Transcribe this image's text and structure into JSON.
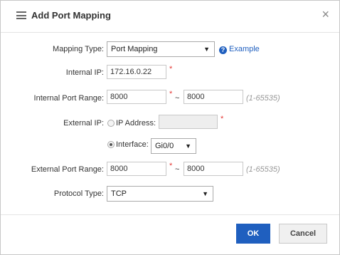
{
  "dialog": {
    "title": "Add Port Mapping",
    "close_glyph": "×"
  },
  "form": {
    "mapping_type": {
      "label": "Mapping Type:",
      "value": "Port Mapping",
      "help": "Example"
    },
    "internal_ip": {
      "label": "Internal IP:",
      "value": "172.16.0.22"
    },
    "internal_port_range": {
      "label": "Internal Port Range:",
      "from": "8000",
      "to": "8000",
      "hint": "(1-65535)"
    },
    "external_ip": {
      "label": "External IP:",
      "option_ip": "IP Address:",
      "ip_value": "",
      "option_interface": "Interface:",
      "interface_value": "Gi0/0",
      "selected": "interface"
    },
    "external_port_range": {
      "label": "External Port Range:",
      "from": "8000",
      "to": "8000",
      "hint": "(1-65535)"
    },
    "protocol_type": {
      "label": "Protocol Type:",
      "value": "TCP"
    },
    "required_mark": "*",
    "range_separator": "~"
  },
  "buttons": {
    "ok": "OK",
    "cancel": "Cancel"
  },
  "colors": {
    "primary": "#1f5fbf",
    "required": "#e53935",
    "hint": "#999999"
  }
}
